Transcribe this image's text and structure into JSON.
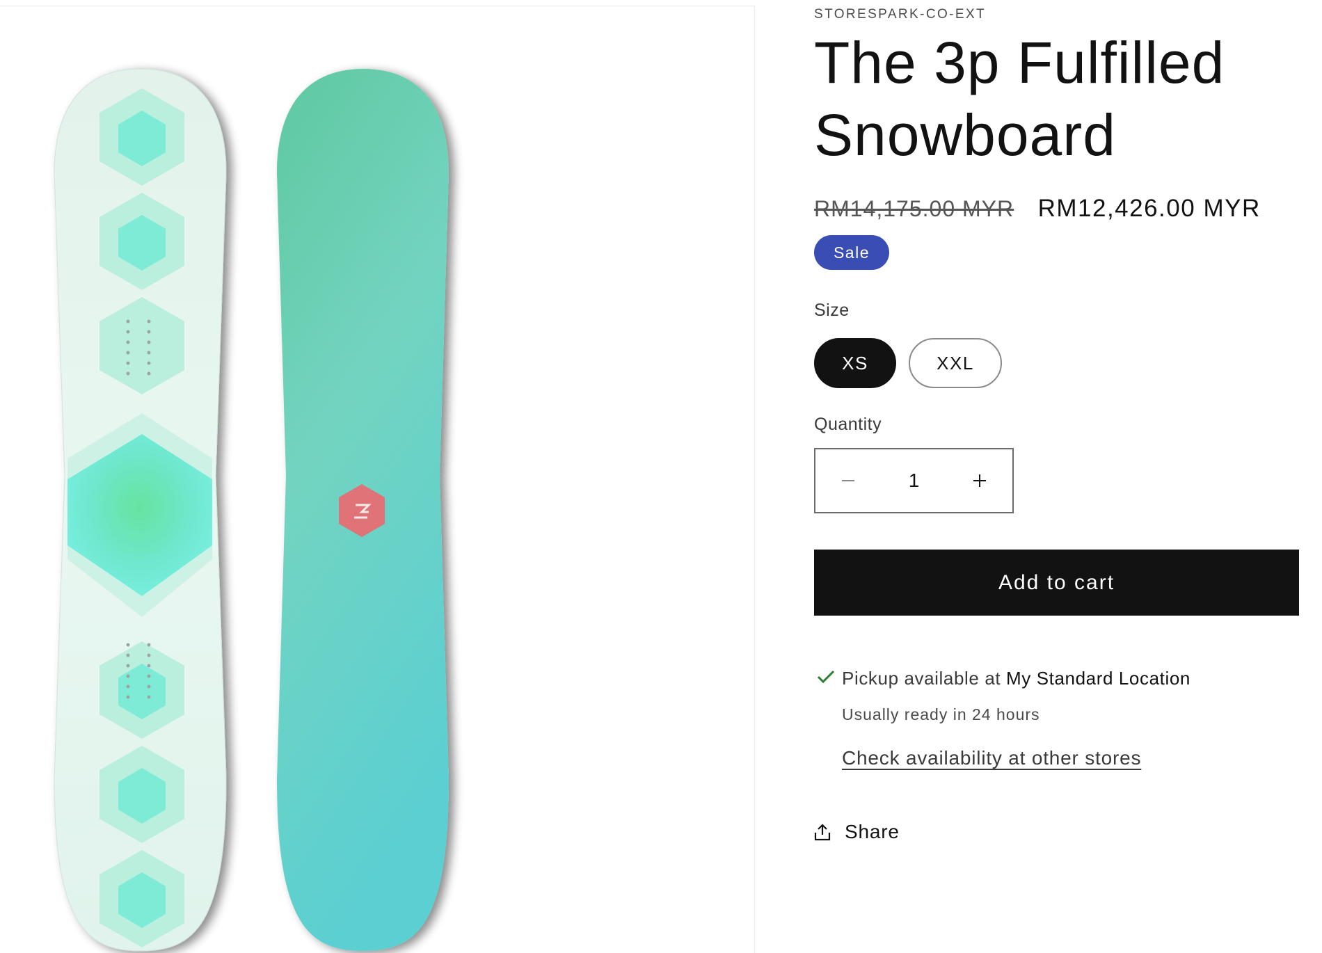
{
  "product": {
    "vendor": "STORESPARK-CO-EXT",
    "title": "The 3p Fulfilled Snowboard",
    "price_regular": "RM14,175.00 MYR",
    "price_sale": "RM12,426.00 MYR",
    "sale_badge": "Sale",
    "image_alt": "snowboard-image"
  },
  "size": {
    "label": "Size",
    "options": [
      "XS",
      "XXL"
    ],
    "selected": "XS"
  },
  "quantity": {
    "label": "Quantity",
    "value": "1"
  },
  "cart": {
    "add_label": "Add to cart"
  },
  "pickup": {
    "prefix": "Pickup available at ",
    "location": "My Standard Location",
    "ready": "Usually ready in 24 hours",
    "check_link": "Check availability at other stores"
  },
  "share": {
    "label": "Share"
  },
  "colors": {
    "sale_badge": "#3a4db4",
    "button_dark": "#121212",
    "check_green": "#2e7d32"
  },
  "icons": {
    "check": "check-icon",
    "minus": "minus-icon",
    "plus": "plus-icon",
    "share": "share-icon"
  }
}
